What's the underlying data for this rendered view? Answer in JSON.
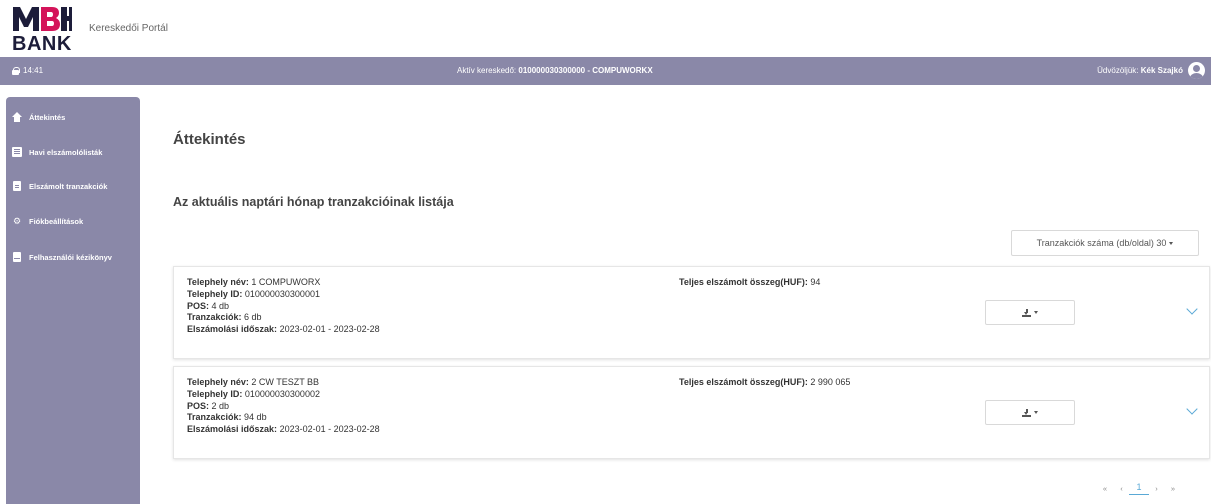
{
  "header": {
    "logo_text": "BANK",
    "portal_name": "Kereskedői Portál"
  },
  "info_bar": {
    "time": "14:41",
    "merchant_label": "Aktív kereskedő:",
    "merchant_value": "010000030300000 - COMPUWORKX",
    "greeting_label": "Üdvözöljük:",
    "user_name": "Kék Szajkó"
  },
  "sidebar": {
    "items": [
      {
        "label": "Áttekintés",
        "icon": "home-icon"
      },
      {
        "label": "Havi elszámolólisták",
        "icon": "list-icon"
      },
      {
        "label": "Elszámolt tranzakciók",
        "icon": "file-icon"
      },
      {
        "label": "Fiókbeállítások",
        "icon": "gear-icon"
      },
      {
        "label": "Felhasználói kézikönyv",
        "icon": "book-icon"
      }
    ]
  },
  "main": {
    "page_title": "Áttekintés",
    "section_title": "Az aktuális naptári hónap tranzakcióinak listája",
    "per_page_label": "Tranzakciók száma (db/oldal) 30",
    "cards": [
      {
        "site_name_label": "Telephely név:",
        "site_name": "1 COMPUWORX",
        "site_id_label": "Telephely ID:",
        "site_id": "010000030300001",
        "pos_label": "POS:",
        "pos": "4 db",
        "tx_label": "Tranzakciók:",
        "tx": "6 db",
        "period_label": "Elszámolási időszak:",
        "period": "2023-02-01 - 2023-02-28",
        "total_label": "Teljes elszámolt összeg(HUF):",
        "total": "94"
      },
      {
        "site_name_label": "Telephely név:",
        "site_name": "2 CW TESZT BB",
        "site_id_label": "Telephely ID:",
        "site_id": "010000030300002",
        "pos_label": "POS:",
        "pos": "2 db",
        "tx_label": "Tranzakciók:",
        "tx": "94 db",
        "period_label": "Elszámolási időszak:",
        "period": "2023-02-01 - 2023-02-28",
        "total_label": "Teljes elszámolt összeg(HUF):",
        "total": "2 990 065"
      }
    ]
  },
  "pagination": {
    "first": "«",
    "prev": "‹",
    "current": "1",
    "next": "›",
    "last": "»"
  },
  "colors": {
    "accent": "#8a88a8",
    "link": "#5aa9d6"
  }
}
